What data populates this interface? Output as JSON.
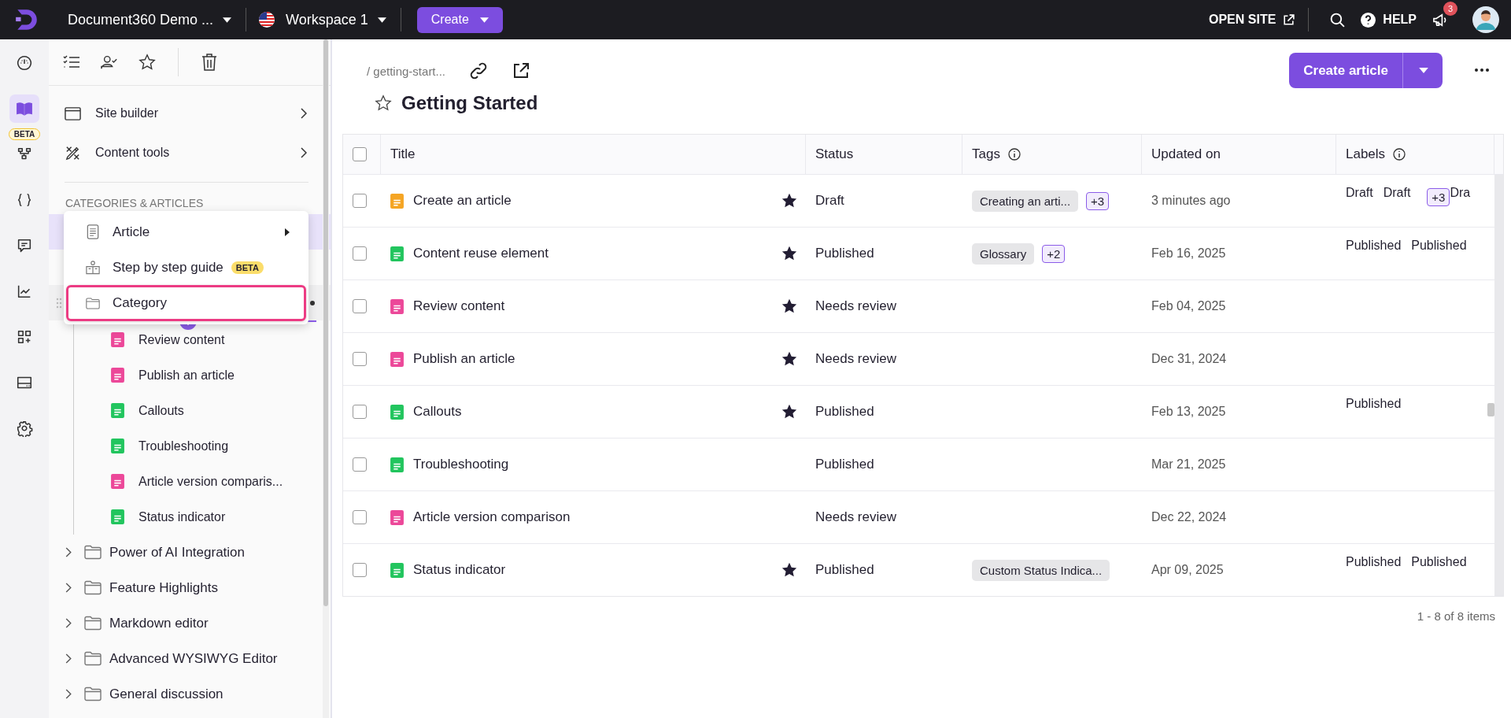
{
  "topbar": {
    "project": "Document360 Demo ...",
    "workspace": "Workspace 1",
    "create": "Create",
    "open_site": "OPEN SITE",
    "help": "HELP",
    "notification_count": "3"
  },
  "rail": [
    {
      "selected": false
    },
    {
      "selected": true
    },
    {
      "selected": false,
      "badge": "BETA"
    },
    {
      "selected": false
    },
    {
      "selected": false
    },
    {
      "selected": false
    },
    {
      "selected": false
    },
    {
      "selected": false
    },
    {
      "selected": false
    }
  ],
  "sidebar": {
    "nav": [
      {
        "label": "Site builder"
      },
      {
        "label": "Content tools"
      }
    ],
    "section": "CATEGORIES & ARTICLES",
    "menu": [
      {
        "label": "Article",
        "submenu": true,
        "highlighted": false
      },
      {
        "label": "Step by step guide",
        "badge": "BETA",
        "submenu": false,
        "highlighted": false
      },
      {
        "label": "Category",
        "submenu": false,
        "highlighted": true
      }
    ],
    "tree": [
      {
        "expanded": true,
        "children": [
          {
            "label": "Review content",
            "color": "#ec4899"
          },
          {
            "label": "Publish an article",
            "color": "#ec4899"
          },
          {
            "label": "Callouts",
            "color": "#22c55e"
          },
          {
            "label": "Troubleshooting",
            "color": "#22c55e"
          },
          {
            "label": "Article version comparis...",
            "color": "#ec4899"
          },
          {
            "label": "Status indicator",
            "color": "#22c55e"
          }
        ]
      },
      {
        "label": "Power of AI Integration",
        "expanded": false
      },
      {
        "label": "Feature Highlights",
        "expanded": false
      },
      {
        "label": "Markdown editor",
        "expanded": false
      },
      {
        "label": "Advanced WYSIWYG Editor",
        "expanded": false
      },
      {
        "label": "General discussion",
        "expanded": false
      }
    ]
  },
  "main": {
    "breadcrumb": "/ getting-start...",
    "title": "Getting Started",
    "favorite": false,
    "create_article": "Create article",
    "table": {
      "all_checked": false,
      "columns": [
        {
          "label": "Title",
          "info": false
        },
        {
          "label": "Status",
          "info": false
        },
        {
          "label": "Tags",
          "info": true
        },
        {
          "label": "Updated on",
          "info": false
        },
        {
          "label": "Labels",
          "info": true
        }
      ],
      "rows": [
        {
          "checked": false,
          "color": "#f5a524",
          "title": "Create an article",
          "starred": true,
          "status": "Draft",
          "tags": [
            {
              "kind": "tag",
              "text": "Creating an arti..."
            },
            {
              "kind": "more",
              "text": "+3"
            }
          ],
          "updated": "3 minutes ago",
          "labels": [
            {
              "kind": "label",
              "text": "Draft"
            },
            {
              "kind": "label",
              "text": "Draft"
            },
            {
              "kind": "more",
              "text": "+3"
            },
            {
              "kind": "label",
              "text": "Dra"
            }
          ]
        },
        {
          "checked": false,
          "color": "#22c55e",
          "title": "Content reuse element",
          "starred": true,
          "status": "Published",
          "tags": [
            {
              "kind": "tag",
              "text": "Glossary"
            },
            {
              "kind": "more",
              "text": "+2"
            }
          ],
          "updated": "Feb 16, 2025",
          "labels": [
            {
              "kind": "label",
              "text": "Published"
            },
            {
              "kind": "label",
              "text": "Published"
            }
          ]
        },
        {
          "checked": false,
          "color": "#ec4899",
          "title": "Review content",
          "starred": true,
          "status": "Needs review",
          "tags": [],
          "updated": "Feb 04, 2025",
          "labels": []
        },
        {
          "checked": false,
          "color": "#ec4899",
          "title": "Publish an article",
          "starred": true,
          "status": "Needs review",
          "tags": [],
          "updated": "Dec 31, 2024",
          "labels": []
        },
        {
          "checked": false,
          "color": "#22c55e",
          "title": "Callouts",
          "starred": true,
          "status": "Published",
          "tags": [],
          "updated": "Feb 13, 2025",
          "labels": [
            {
              "kind": "label",
              "text": "Published"
            },
            {
              "kind": "clipped"
            }
          ]
        },
        {
          "checked": false,
          "color": "#22c55e",
          "title": "Troubleshooting",
          "starred": false,
          "status": "Published",
          "tags": [],
          "updated": "Mar 21, 2025",
          "labels": []
        },
        {
          "checked": false,
          "color": "#ec4899",
          "title": "Article version comparison",
          "starred": false,
          "status": "Needs review",
          "tags": [],
          "updated": "Dec 22, 2024",
          "labels": []
        },
        {
          "checked": false,
          "color": "#22c55e",
          "title": "Status indicator",
          "starred": true,
          "status": "Published",
          "tags": [
            {
              "kind": "tag",
              "text": "Custom Status Indica..."
            }
          ],
          "updated": "Apr 09, 2025",
          "labels": [
            {
              "kind": "label",
              "text": "Published"
            },
            {
              "kind": "label",
              "text": "Published"
            }
          ]
        }
      ]
    },
    "footer": "1 - 8 of 8 items"
  }
}
